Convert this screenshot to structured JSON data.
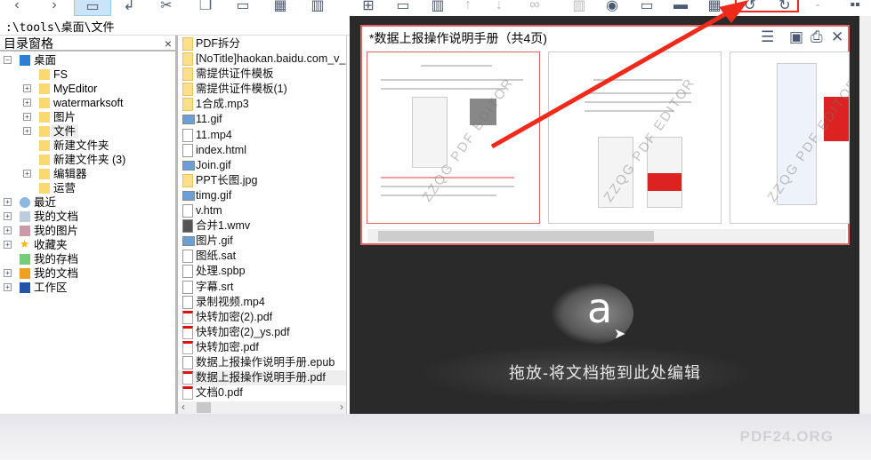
{
  "toolbar": {
    "icons": [
      "back-icon",
      "forward-icon",
      "copy-icon",
      "undo-icon",
      "cut-icon",
      "copy-pages-icon",
      "paste-icon",
      "grid-icon",
      "delete-icon",
      "new-icon",
      "save-icon",
      "trash-icon",
      "insert-icon",
      "down-icon",
      "rings-icon",
      "columns-icon",
      "record-icon",
      "frame-icon",
      "print-icon",
      "calculator-icon",
      "rotate-left-icon",
      "rotate-right-icon",
      "minus-icon",
      "more-icon"
    ]
  },
  "address": {
    "path": ":\\tools\\桌面\\文件"
  },
  "tree": {
    "title": "目录窗格",
    "close": "×",
    "items": [
      {
        "label": "桌面",
        "level": 0,
        "expander": "−",
        "icon": "desktop"
      },
      {
        "label": "FS",
        "level": 1,
        "expander": "",
        "icon": "folder"
      },
      {
        "label": "MyEditor",
        "level": 1,
        "expander": "+",
        "icon": "folder"
      },
      {
        "label": "watermarksoft",
        "level": 1,
        "expander": "+",
        "icon": "folder"
      },
      {
        "label": "图片",
        "level": 1,
        "expander": "+",
        "icon": "folder"
      },
      {
        "label": "文件",
        "level": 1,
        "expander": "+",
        "icon": "folder",
        "selected": true
      },
      {
        "label": "新建文件夹",
        "level": 1,
        "expander": "",
        "icon": "folder"
      },
      {
        "label": "新建文件夹 (3)",
        "level": 1,
        "expander": "",
        "icon": "folder"
      },
      {
        "label": "编辑器",
        "level": 1,
        "expander": "+",
        "icon": "folder"
      },
      {
        "label": "运营",
        "level": 1,
        "expander": "",
        "icon": "folder"
      },
      {
        "label": "最近",
        "level": 0,
        "expander": "+",
        "icon": "clock"
      },
      {
        "label": "我的文档",
        "level": 0,
        "expander": "+",
        "icon": "docs"
      },
      {
        "label": "我的图片",
        "level": 0,
        "expander": "+",
        "icon": "pictures"
      },
      {
        "label": "收藏夹",
        "level": 0,
        "expander": "+",
        "icon": "star"
      },
      {
        "label": "我的存档",
        "level": 0,
        "expander": "",
        "icon": "archive"
      },
      {
        "label": "我的文档",
        "level": 0,
        "expander": "+",
        "icon": "docs2"
      },
      {
        "label": "工作区",
        "level": 0,
        "expander": "+",
        "icon": "workspace"
      }
    ]
  },
  "files": [
    {
      "name": "PDF拆分",
      "type": "folder"
    },
    {
      "name": "[NoTitle]haokan.baidu.com_v_",
      "type": "folder"
    },
    {
      "name": "需提供证件模板",
      "type": "folder"
    },
    {
      "name": "需提供证件模板(1)",
      "type": "folder"
    },
    {
      "name": "1合成.mp3",
      "type": "folder"
    },
    {
      "name": "11.gif",
      "type": "img"
    },
    {
      "name": "11.mp4",
      "type": "doc"
    },
    {
      "name": "index.html",
      "type": "doc"
    },
    {
      "name": "Join.gif",
      "type": "img"
    },
    {
      "name": "PPT长图.jpg",
      "type": "folder"
    },
    {
      "name": "timg.gif",
      "type": "img"
    },
    {
      "name": "v.htm",
      "type": "doc"
    },
    {
      "name": "合并1.wmv",
      "type": "vid"
    },
    {
      "name": "图片.gif",
      "type": "img"
    },
    {
      "name": "图纸.sat",
      "type": "doc"
    },
    {
      "name": "处理.spbp",
      "type": "doc"
    },
    {
      "name": "字幕.srt",
      "type": "doc"
    },
    {
      "name": "录制视频.mp4",
      "type": "doc"
    },
    {
      "name": "快转加密(2).pdf",
      "type": "pdf"
    },
    {
      "name": "快转加密(2)_ys.pdf",
      "type": "pdf"
    },
    {
      "name": "快转加密.pdf",
      "type": "pdf"
    },
    {
      "name": "数据上报操作说明手册.epub",
      "type": "doc"
    },
    {
      "name": "数据上报操作说明手册.pdf",
      "type": "pdf",
      "selected": true
    },
    {
      "name": "文档0.pdf",
      "type": "pdf"
    }
  ],
  "document": {
    "title": "*数据上报操作说明手册（共4页)",
    "watermark": "ZZQG PDF EDITOR",
    "page_count": 4
  },
  "dropzone": {
    "logo_letter": "a",
    "text": "拖放-将文档拖到此处编辑"
  },
  "brand": "PDF24.ORG",
  "colors": {
    "highlight": "#f02a1a",
    "panel_border": "#e06464",
    "dark_bg": "#2a2a2a",
    "icon": "#4b5a74"
  }
}
